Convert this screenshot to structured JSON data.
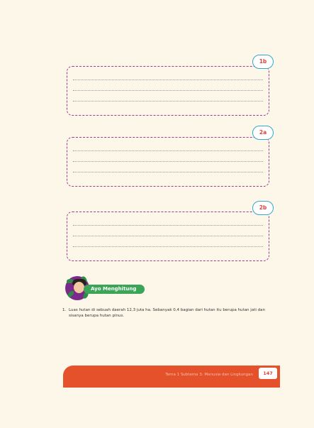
{
  "boxes": [
    {
      "tag": "1b",
      "lines": 3
    },
    {
      "tag": "2a",
      "lines": 3
    },
    {
      "tag": "2b",
      "lines": 3
    }
  ],
  "ayo": {
    "label": "Ayo Menghitung"
  },
  "question": {
    "number": "1.",
    "text": "Luas hutan di sebuah daerah 12,3 juta ha. Sebanyak 0,4 bagian dari hutan itu berupa hutan jati dan sisanya berupa hutan pinus."
  },
  "footer": {
    "text": "Tema 1 Subtema 3: Manusia dan Lingkungan",
    "page_number": "147"
  },
  "colors": {
    "background": "#fdf7ea",
    "box_border": "#a23a92",
    "tag_border": "#33a7c9",
    "tag_text": "#e0433b",
    "banner": "#3aa457",
    "footer": "#e4512a"
  }
}
